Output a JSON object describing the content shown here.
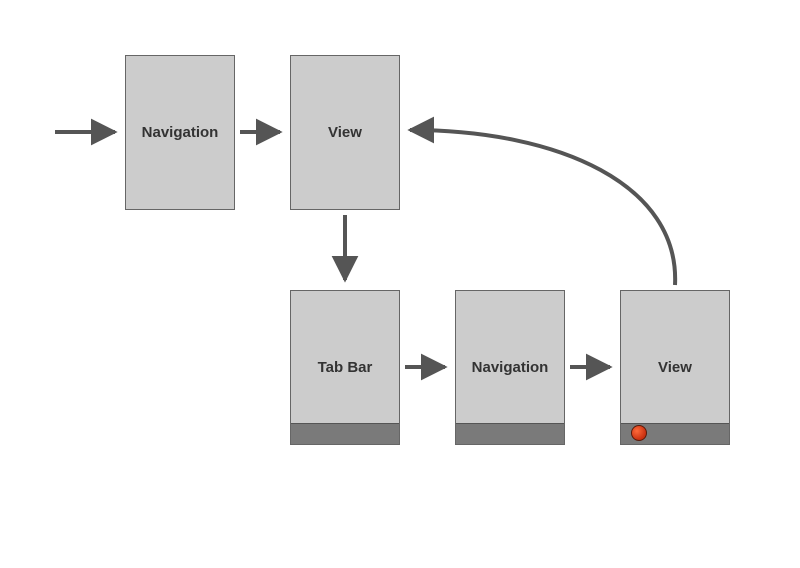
{
  "diagram": {
    "nodes": {
      "navigation_top": {
        "label": "Navigation"
      },
      "view_top": {
        "label": "View"
      },
      "tab_bar": {
        "label": "Tab Bar"
      },
      "navigation_bot": {
        "label": "Navigation"
      },
      "view_bot": {
        "label": "View"
      }
    },
    "edges": [
      {
        "from": "entry",
        "to": "navigation_top"
      },
      {
        "from": "navigation_top",
        "to": "view_top"
      },
      {
        "from": "view_top",
        "to": "tab_bar"
      },
      {
        "from": "tab_bar",
        "to": "navigation_bot"
      },
      {
        "from": "navigation_bot",
        "to": "view_bot"
      },
      {
        "from": "view_bot",
        "to": "view_top",
        "curved": true
      }
    ],
    "tab_indicator_on": "view_bot"
  }
}
